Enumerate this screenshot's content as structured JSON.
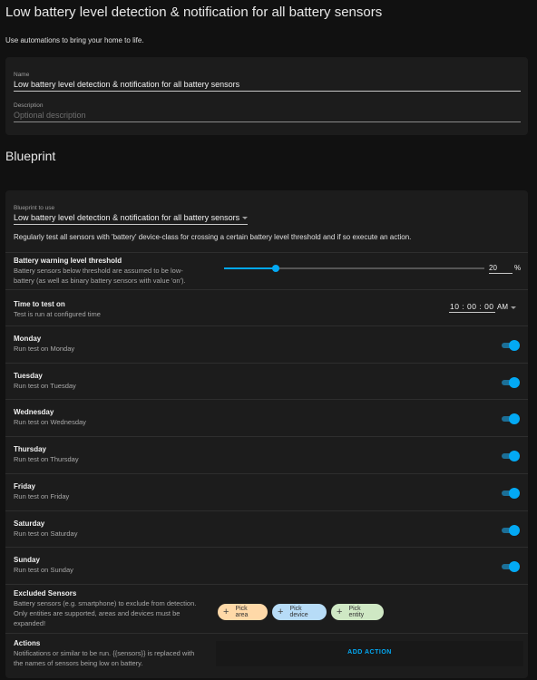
{
  "page": {
    "title": "Low battery level detection & notification for all battery sensors",
    "subtitle": "Use automations to bring your home to life."
  },
  "details": {
    "name_label": "Name",
    "name_value": "Low battery level detection & notification for all battery sensors",
    "description_label": "Description",
    "description_placeholder": "Optional description"
  },
  "blueprint": {
    "section_title": "Blueprint",
    "select_label": "Blueprint to use",
    "selected": "Low battery level detection & notification for all battery sensors",
    "description": "Regularly test all sensors with 'battery' device-class for crossing a certain battery level threshold and if so execute an action.",
    "threshold": {
      "name": "Battery warning level threshold",
      "desc_line1": "Battery sensors below threshold are assumed to be low-",
      "desc_line2": "battery (as well as binary battery sensors with value 'on').",
      "value": "20",
      "unit": "%",
      "min": 0,
      "max": 100
    },
    "time": {
      "name": "Time to test on",
      "desc": "Test is run at configured time",
      "value": "10 : 00 : 00",
      "ampm": "AM"
    },
    "days": [
      {
        "name": "Monday",
        "desc": "Run test on Monday",
        "on": true
      },
      {
        "name": "Tuesday",
        "desc": "Run test on Tuesday",
        "on": true
      },
      {
        "name": "Wednesday",
        "desc": "Run test on Wednesday",
        "on": true
      },
      {
        "name": "Thursday",
        "desc": "Run test on Thursday",
        "on": true
      },
      {
        "name": "Friday",
        "desc": "Run test on Friday",
        "on": true
      },
      {
        "name": "Saturday",
        "desc": "Run test on Saturday",
        "on": true
      },
      {
        "name": "Sunday",
        "desc": "Run test on Sunday",
        "on": true
      }
    ],
    "excluded": {
      "name": "Excluded Sensors",
      "desc_line1": "Battery sensors (e.g. smartphone) to exclude from detection.",
      "desc_line2": "Only entities are supported, areas and devices must be",
      "desc_line3": "expanded!",
      "pick_area": "Pick area",
      "pick_device": "Pick device",
      "pick_entity": "Pick entity"
    },
    "actions": {
      "name": "Actions",
      "desc_line1": "Notifications or similar to be run. {{sensors}} is replaced with",
      "desc_line2": "the names of sensors being low on battery.",
      "add_action": "ADD ACTION"
    }
  },
  "colors": {
    "accent": "#03a9f4",
    "chip_area": "#ffd9a8",
    "chip_device": "#b7dcf7",
    "chip_entity": "#cfe8c4"
  }
}
